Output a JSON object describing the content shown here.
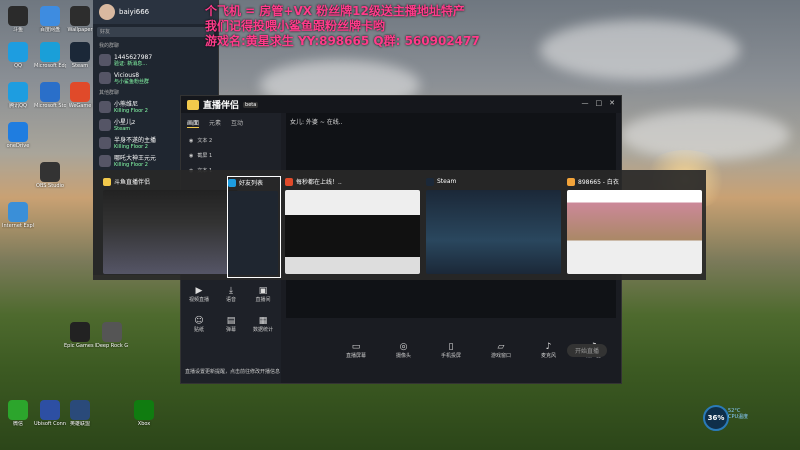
{
  "overlay": {
    "line1": "个飞机 = 房管+VX 粉丝牌12级送主播地址特产",
    "line2": "我们记得投喂小鲨鱼跟粉丝牌卡哟",
    "line3": "游戏名:黄星求生 YY:898665 Q群: 560902477"
  },
  "desktop_icons": [
    {
      "label": "斗鱼",
      "color": "#2b2b2b"
    },
    {
      "label": "百度网盘",
      "color": "#3e8ce0"
    },
    {
      "label": "Wallpaper",
      "color": "#2d2d2d"
    },
    {
      "label": "QQ",
      "color": "#1e9de0"
    },
    {
      "label": "Microsoft Edge",
      "color": "#1a9fd8"
    },
    {
      "label": "Steam",
      "color": "#1b2838"
    },
    {
      "label": "腾讯QQ",
      "color": "#1e9de0"
    },
    {
      "label": "Microsoft Store",
      "color": "#2a6fc9"
    },
    {
      "label": "WeGame",
      "color": "#e04a2a"
    },
    {
      "label": "oneDrive",
      "color": "#1f7de0"
    },
    {
      "label": "OBS Studio",
      "color": "#333"
    },
    {
      "label": "Internet Explorer",
      "color": "#3a8fd8"
    },
    {
      "label": "Epic Games Launcher",
      "color": "#222"
    },
    {
      "label": "Deep Rock Galactic",
      "color": "#555"
    },
    {
      "label": "微信",
      "color": "#2ca52c"
    },
    {
      "label": "Ubisoft Connect",
      "color": "#2d4fa3"
    },
    {
      "label": "英雄联盟",
      "color": "#2a4a7a"
    },
    {
      "label": "Xbox",
      "color": "#107c10"
    }
  ],
  "qq": {
    "username": "baiyi666",
    "search_placeholder": "好友",
    "section1": "我的群聊",
    "contacts": [
      {
        "title": "1445627987",
        "sub": "验证: 新消息..."
      },
      {
        "title": "Vicious8",
        "sub": "与小鲨鱼粉丝群"
      },
      {
        "title": "小熊维尼",
        "sub": "Killing Floor 2"
      },
      {
        "title": "小星儿z",
        "sub": "Steam"
      },
      {
        "title": "半身不遂的主播",
        "sub": "Killing Floor 2"
      },
      {
        "title": "哪吒大神王元元",
        "sub": "Killing Floor 2"
      }
    ],
    "section2": "其他群聊"
  },
  "app": {
    "title": "直播伴侣",
    "version": "beta",
    "tabs": [
      "画面",
      "元素",
      "互动"
    ],
    "scenes": [
      "文本 2",
      "截屏 1",
      "文本 1"
    ],
    "stream_title": "女儿: 外婆 ~ 在线..",
    "bottom": [
      {
        "icon": "monitor",
        "label": "直播屏幕"
      },
      {
        "icon": "camera",
        "label": "摄像头"
      },
      {
        "icon": "phone",
        "label": "手机投屏"
      },
      {
        "icon": "game",
        "label": "游戏窗口"
      },
      {
        "icon": "mic",
        "label": "麦克风"
      },
      {
        "icon": "speaker",
        "label": "扬声器"
      }
    ],
    "tools": [
      {
        "label": "视频直播"
      },
      {
        "label": "语音"
      },
      {
        "label": "直播间"
      },
      {
        "label": "贴纸"
      },
      {
        "label": "弹幕"
      },
      {
        "label": "数据统计"
      }
    ],
    "go_live": "开始直播",
    "notice": "直播设置更新提醒，点击前往修改开播信息"
  },
  "alttab": [
    {
      "title": "斗鱼直播伴侣",
      "icon_color": "#f2c94c"
    },
    {
      "title": "好友列表",
      "icon_color": "#1e9de0"
    },
    {
      "title": "每秒都在上线！..",
      "icon_color": "#e04a2a"
    },
    {
      "title": "Steam",
      "icon_color": "#1b2838"
    },
    {
      "title": "898665 - 白衣",
      "icon_color": "#f2a33a"
    }
  ],
  "system": {
    "cpu_value": "36%",
    "temp": "52°C",
    "cpu_label": "CPU温度"
  }
}
